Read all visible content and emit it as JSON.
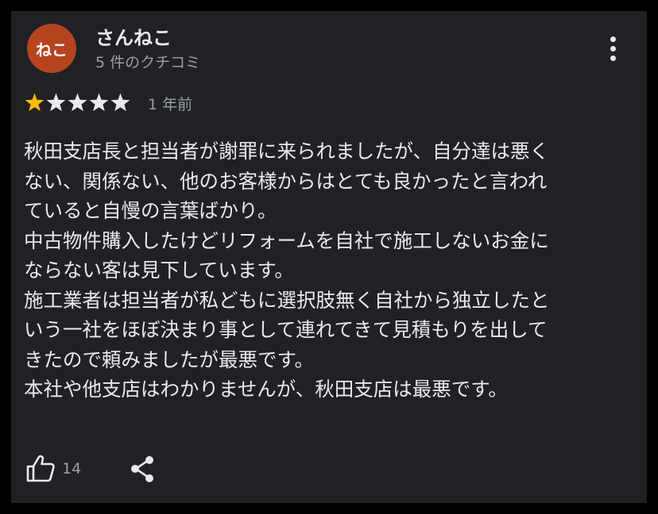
{
  "reviewer": {
    "avatar_text": "ねこ",
    "avatar_color": "#b5441f",
    "name": "さんねこ",
    "review_count": "5 件のクチコミ"
  },
  "menu": {
    "icon": "more-vert-icon"
  },
  "rating": {
    "stars": 1,
    "max": 5,
    "filled_color": "#fbbc04",
    "empty_color": "#e8eaed",
    "time_ago": "1 年前"
  },
  "review": {
    "lines": [
      "秋田支店長と担当者が謝罪に来られましたが、自分達は悪く",
      "ない、関係ない、他のお客様からはとても良かったと言われ",
      "ていると自慢の言葉ばかり。",
      "中古物件購入したけどリフォームを自社で施工しないお金に",
      "ならない客は見下しています。",
      "施工業者は担当者が私どもに選択肢無く自社から独立したと",
      "いう一社をほぼ決まり事として連れてきて見積もりを出して",
      "きたので頼みましたが最悪です。",
      "本社や他支店はわかりませんが、秋田支店は最悪です。"
    ]
  },
  "actions": {
    "like_icon": "thumbs-up-icon",
    "like_count": "14",
    "share_icon": "share-icon"
  }
}
